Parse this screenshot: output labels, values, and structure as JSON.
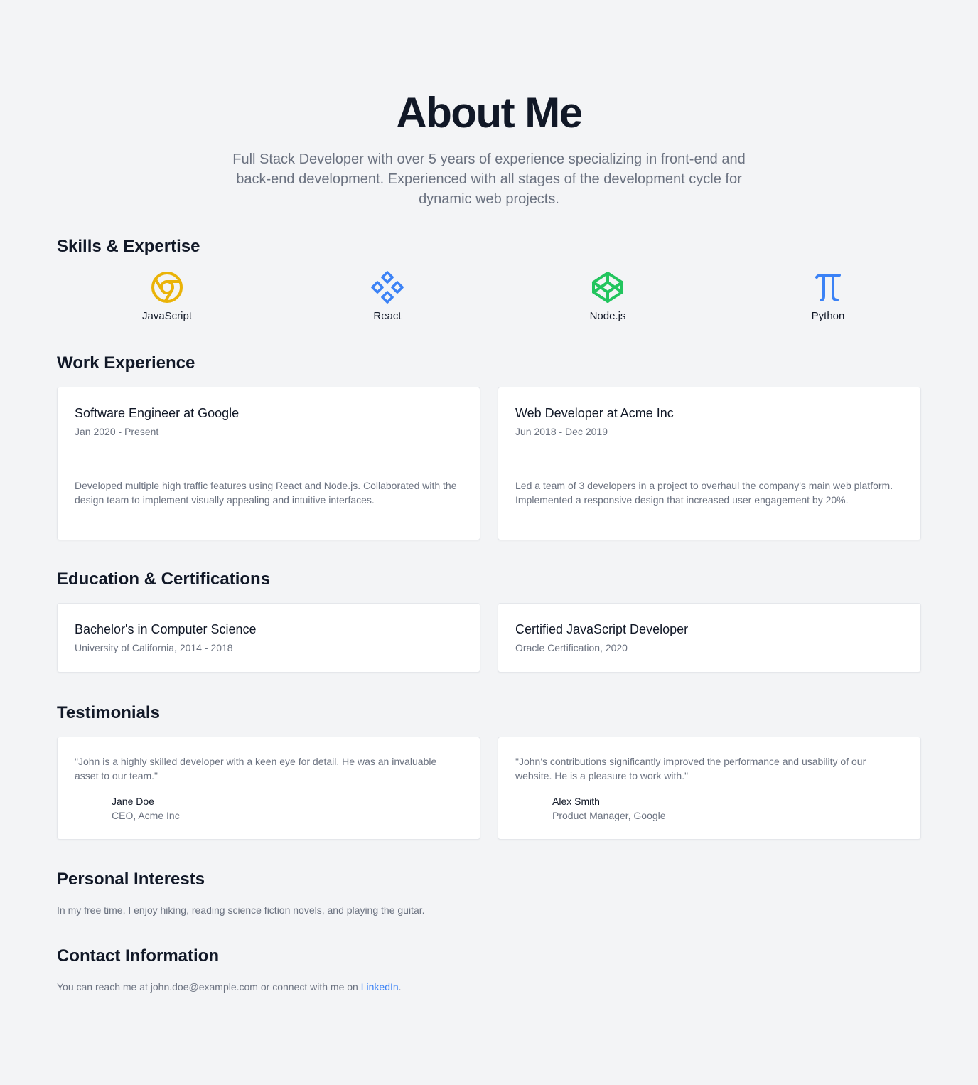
{
  "hero": {
    "title": "About Me",
    "subtitle": "Full Stack Developer with over 5 years of experience specializing in front-end and back-end development. Experienced with all stages of the development cycle for dynamic web projects."
  },
  "skills": {
    "title": "Skills & Expertise",
    "items": [
      {
        "label": "JavaScript",
        "icon": "chrome-icon",
        "color": "#eab308"
      },
      {
        "label": "React",
        "icon": "diamond-grid-icon",
        "color": "#3b82f6"
      },
      {
        "label": "Node.js",
        "icon": "codepen-icon",
        "color": "#22c55e"
      },
      {
        "label": "Python",
        "icon": "pi-icon",
        "color": "#3b82f6"
      }
    ]
  },
  "work": {
    "title": "Work Experience",
    "items": [
      {
        "role": "Software Engineer at Google",
        "dates": "Jan 2020 - Present",
        "desc": "Developed multiple high traffic features using React and Node.js. Collaborated with the design team to implement visually appealing and intuitive interfaces."
      },
      {
        "role": "Web Developer at Acme Inc",
        "dates": "Jun 2018 - Dec 2019",
        "desc": "Led a team of 3 developers in a project to overhaul the company's main web platform. Implemented a responsive design that increased user engagement by 20%."
      }
    ]
  },
  "education": {
    "title": "Education & Certifications",
    "items": [
      {
        "title": "Bachelor's in Computer Science",
        "detail": "University of California, 2014 - 2018"
      },
      {
        "title": "Certified JavaScript Developer",
        "detail": "Oracle Certification, 2020"
      }
    ]
  },
  "testimonials": {
    "title": "Testimonials",
    "items": [
      {
        "quote": "\"John is a highly skilled developer with a keen eye for detail. He was an invaluable asset to our team.\"",
        "name": "Jane Doe",
        "role": "CEO, Acme Inc"
      },
      {
        "quote": "\"John's contributions significantly improved the performance and usability of our website. He is a pleasure to work with.\"",
        "name": "Alex Smith",
        "role": "Product Manager, Google"
      }
    ]
  },
  "interests": {
    "title": "Personal Interests",
    "text": "In my free time, I enjoy hiking, reading science fiction novels, and playing the guitar."
  },
  "contact": {
    "title": "Contact Information",
    "text_before": "You can reach me at john.doe@example.com or connect with me on ",
    "link_label": "LinkedIn",
    "text_after": "."
  }
}
